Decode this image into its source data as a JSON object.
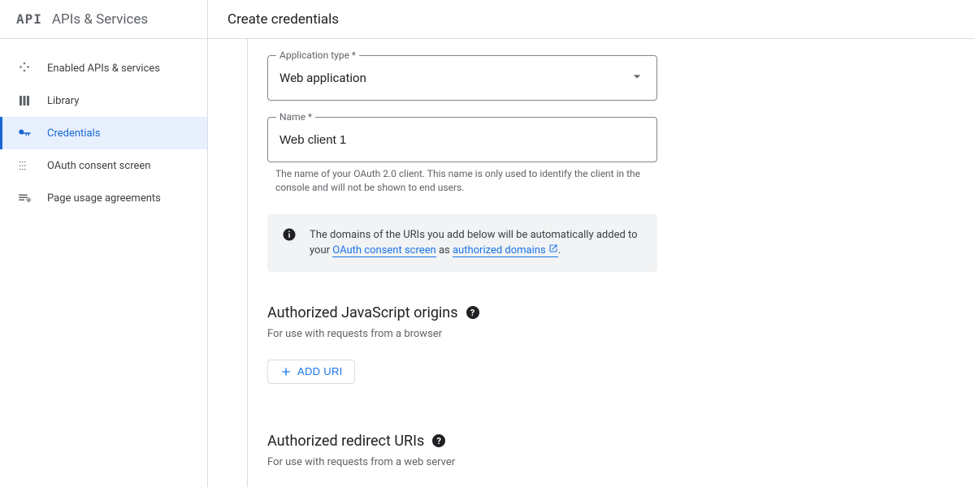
{
  "sidebar": {
    "logo": "API",
    "title": "APIs & Services",
    "items": [
      {
        "label": "Enabled APIs & services"
      },
      {
        "label": "Library"
      },
      {
        "label": "Credentials"
      },
      {
        "label": "OAuth consent screen"
      },
      {
        "label": "Page usage agreements"
      }
    ]
  },
  "header": {
    "title": "Create credentials"
  },
  "form": {
    "app_type_label": "Application type *",
    "app_type_value": "Web application",
    "name_label": "Name *",
    "name_value": "Web client 1",
    "name_helper": "The name of your OAuth 2.0 client. This name is only used to identify the client in the console and will not be shown to end users."
  },
  "info": {
    "text1": "The domains of the URIs you add below will be automatically added to your ",
    "link1": "OAuth consent screen",
    "text2": " as ",
    "link2": "authorized domains",
    "text3": "."
  },
  "js_origins": {
    "title": "Authorized JavaScript origins",
    "desc": "For use with requests from a browser",
    "button": "ADD URI"
  },
  "redirect_uris": {
    "title": "Authorized redirect URIs",
    "desc": "For use with requests from a web server"
  }
}
